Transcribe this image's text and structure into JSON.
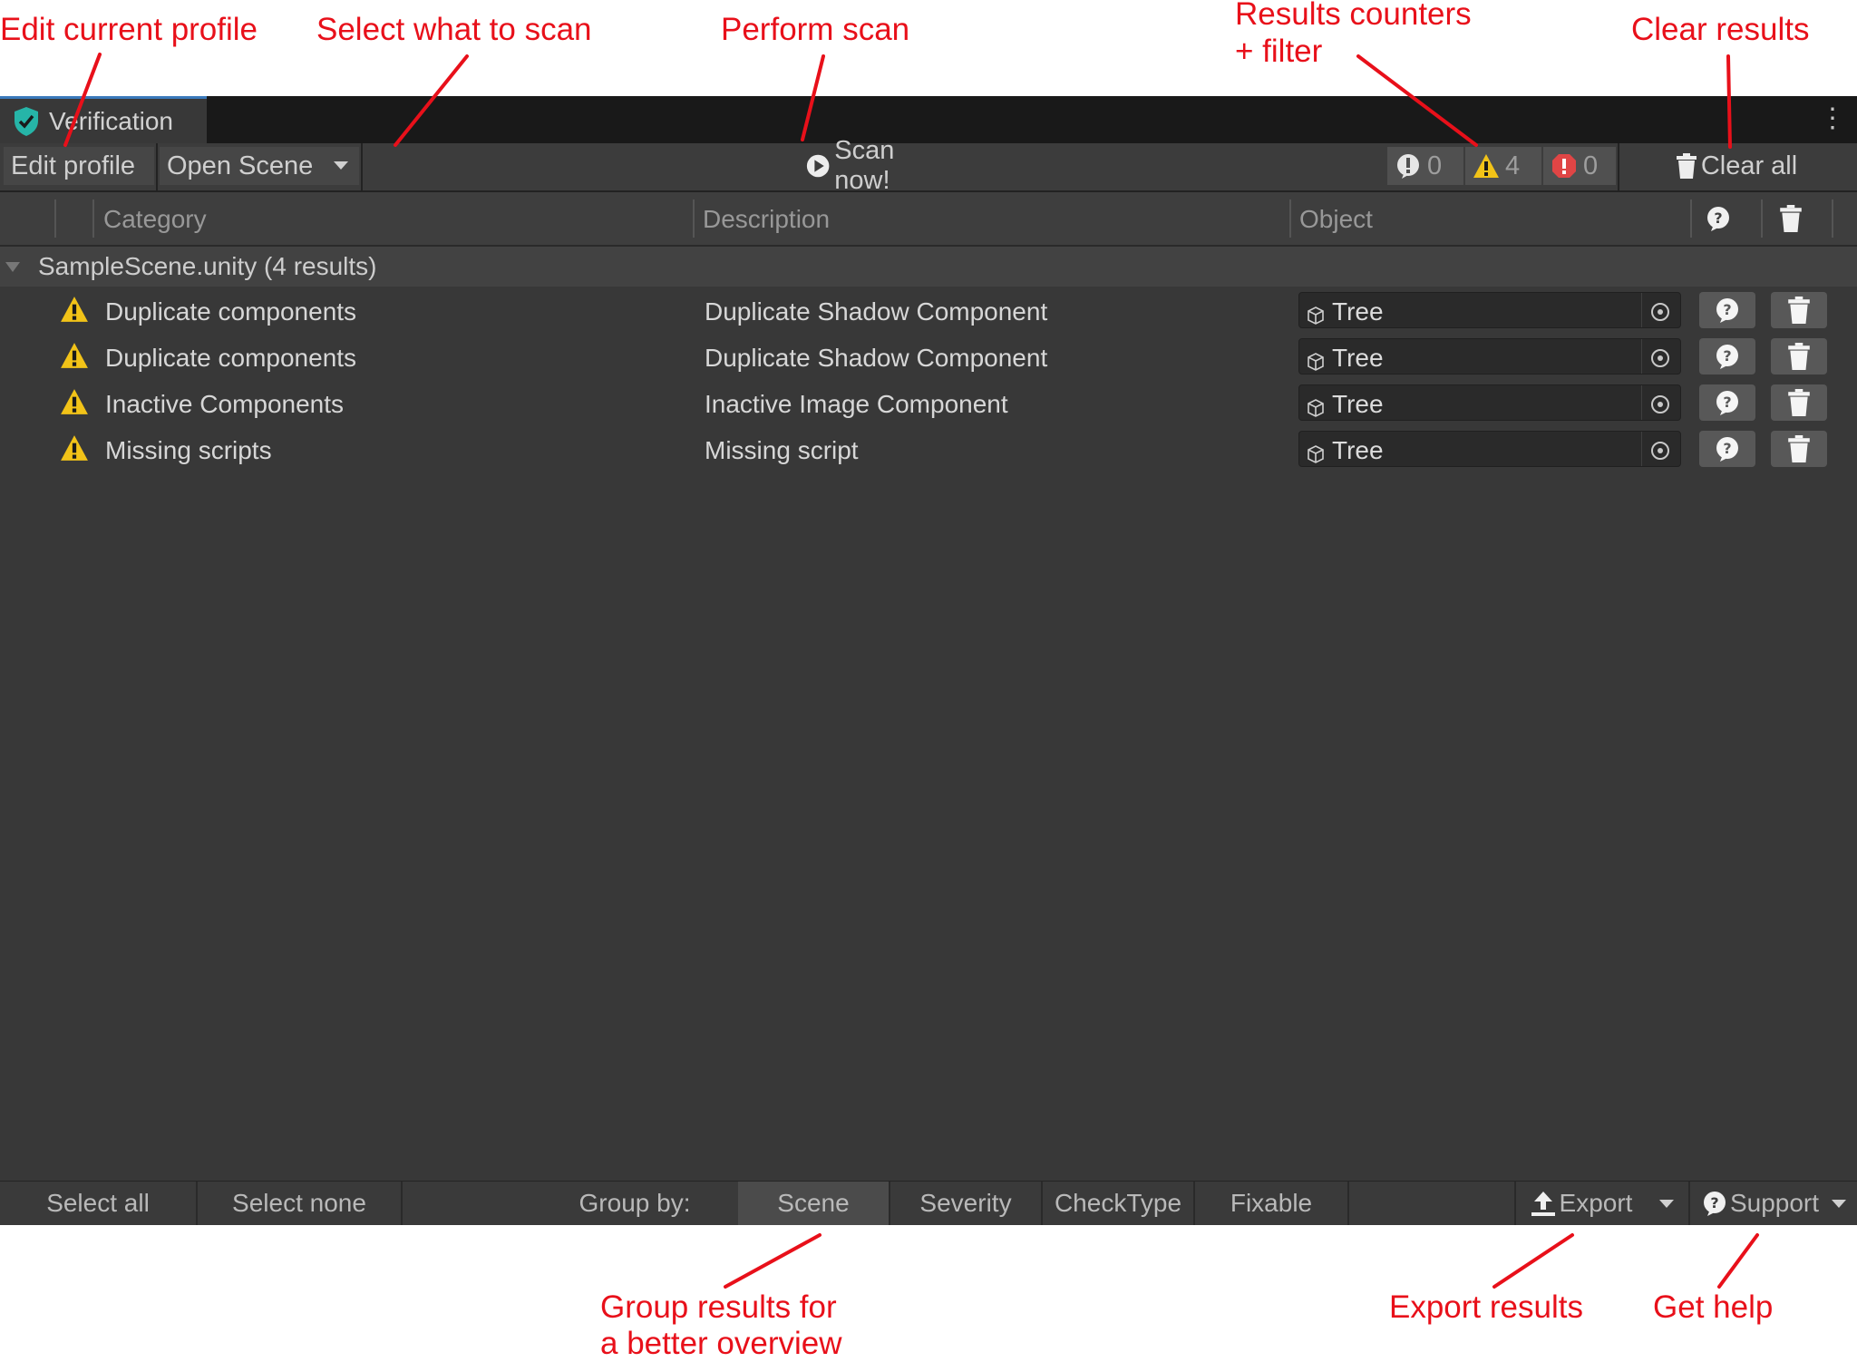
{
  "annotations": {
    "edit_profile": "Edit current profile",
    "select_scan": "Select what to scan",
    "perform_scan": "Perform scan",
    "results_counters_1": "Results counters",
    "results_counters_2": "+ filter",
    "clear_results": "Clear results",
    "group_results_1": "Group results for",
    "group_results_2": "a better overview",
    "export_results": "Export results",
    "get_help": "Get help"
  },
  "window": {
    "tab_title": "Verification",
    "toolbar": {
      "edit_profile": "Edit profile",
      "scope_selected": "Open Scene",
      "scan_now": "Scan now!",
      "info_count": "0",
      "warning_count": "4",
      "error_count": "0",
      "clear_all": "Clear all"
    },
    "columns": {
      "category": "Category",
      "description": "Description",
      "object": "Object"
    },
    "group": {
      "label": "SampleScene.unity (4 results)"
    },
    "rows": [
      {
        "category": "Duplicate components",
        "description": "Duplicate Shadow Component",
        "object": "Tree"
      },
      {
        "category": "Duplicate components",
        "description": "Duplicate Shadow Component",
        "object": "Tree"
      },
      {
        "category": "Inactive Components",
        "description": "Inactive Image Component",
        "object": "Tree"
      },
      {
        "category": "Missing scripts",
        "description": "Missing script",
        "object": "Tree"
      }
    ],
    "bottom": {
      "select_all": "Select all",
      "select_none": "Select none",
      "group_by_label": "Group by:",
      "group_options": [
        "Scene",
        "Severity",
        "CheckType",
        "Fixable"
      ],
      "group_selected": "Scene",
      "export": "Export",
      "support": "Support"
    }
  },
  "colors": {
    "annotation": "#e8101a",
    "warning": "#f2c318",
    "error": "#e04545",
    "accent": "#26b5a8"
  },
  "icons": [
    "shield-check-icon",
    "kebab-menu-icon",
    "dropdown-arrow-icon",
    "play-icon",
    "info-icon",
    "warning-icon",
    "error-icon",
    "trash-icon",
    "help-icon",
    "cube-icon",
    "target-icon",
    "export-icon",
    "foldout-arrow-icon"
  ]
}
